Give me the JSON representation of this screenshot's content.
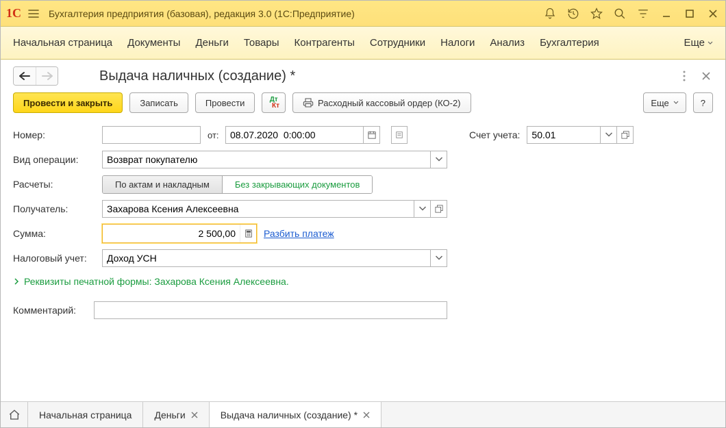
{
  "titlebar": {
    "app_title": "Бухгалтерия предприятия (базовая), редакция 3.0  (1С:Предприятие)"
  },
  "mainmenu": {
    "items": [
      "Начальная страница",
      "Документы",
      "Деньги",
      "Товары",
      "Контрагенты",
      "Сотрудники",
      "Налоги",
      "Анализ",
      "Бухгалтерия"
    ],
    "more": "Еще"
  },
  "doc": {
    "title": "Выдача наличных (создание) *"
  },
  "toolbar": {
    "post_close": "Провести и закрыть",
    "save": "Записать",
    "post": "Провести",
    "print_ko2": "Расходный кассовый ордер (КО-2)",
    "more": "Еще",
    "help": "?"
  },
  "form": {
    "number_label": "Номер:",
    "number_value": "",
    "from_label": "от:",
    "date_value": "08.07.2020  0:00:00",
    "account_label": "Счет учета:",
    "account_value": "50.01",
    "op_type_label": "Вид операции:",
    "op_type_value": "Возврат покупателю",
    "calc_label": "Расчеты:",
    "calc_opt1": "По актам и накладным",
    "calc_opt2": "Без закрывающих документов",
    "payee_label": "Получатель:",
    "payee_value": "Захарова Ксения Алексеевна",
    "sum_label": "Сумма:",
    "sum_value": "2 500,00",
    "split_link": "Разбить платеж",
    "tax_label": "Налоговый учет:",
    "tax_value": "Доход УСН",
    "print_details": "Реквизиты печатной формы: Захарова Ксения Алексеевна.",
    "comment_label": "Комментарий:",
    "comment_value": ""
  },
  "tabs": {
    "home": "Начальная страница",
    "money": "Деньги",
    "doc": "Выдача наличных (создание) *"
  }
}
